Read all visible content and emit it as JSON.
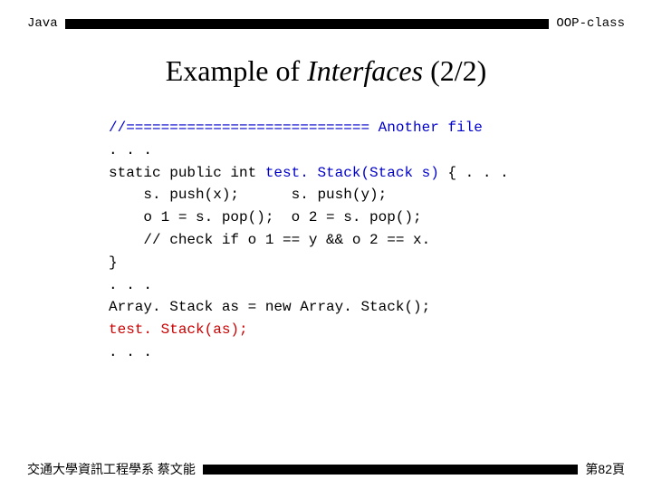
{
  "header": {
    "left": "Java",
    "right": "OOP-class"
  },
  "title": {
    "pre": "Example of ",
    "italic": "Interfaces",
    "post": " (2/2)"
  },
  "code": {
    "l1": "//============================ Another file",
    "l2": ". . .",
    "l3a": "static public int ",
    "l3b": "test. Stack(Stack s)",
    "l3c": " { . . .",
    "l4": "    s. push(x);      s. push(y);",
    "l5": "    o 1 = s. pop();  o 2 = s. pop();",
    "l6": "    // check if o 1 == y && o 2 == x.",
    "l7": "}",
    "l8": ". . .",
    "l9": "Array. Stack as = new Array. Stack();",
    "l10": "test. Stack(as);",
    "l11": ". . ."
  },
  "footer": {
    "left": "交通大學資訊工程學系 蔡文能",
    "right": "第82頁"
  }
}
